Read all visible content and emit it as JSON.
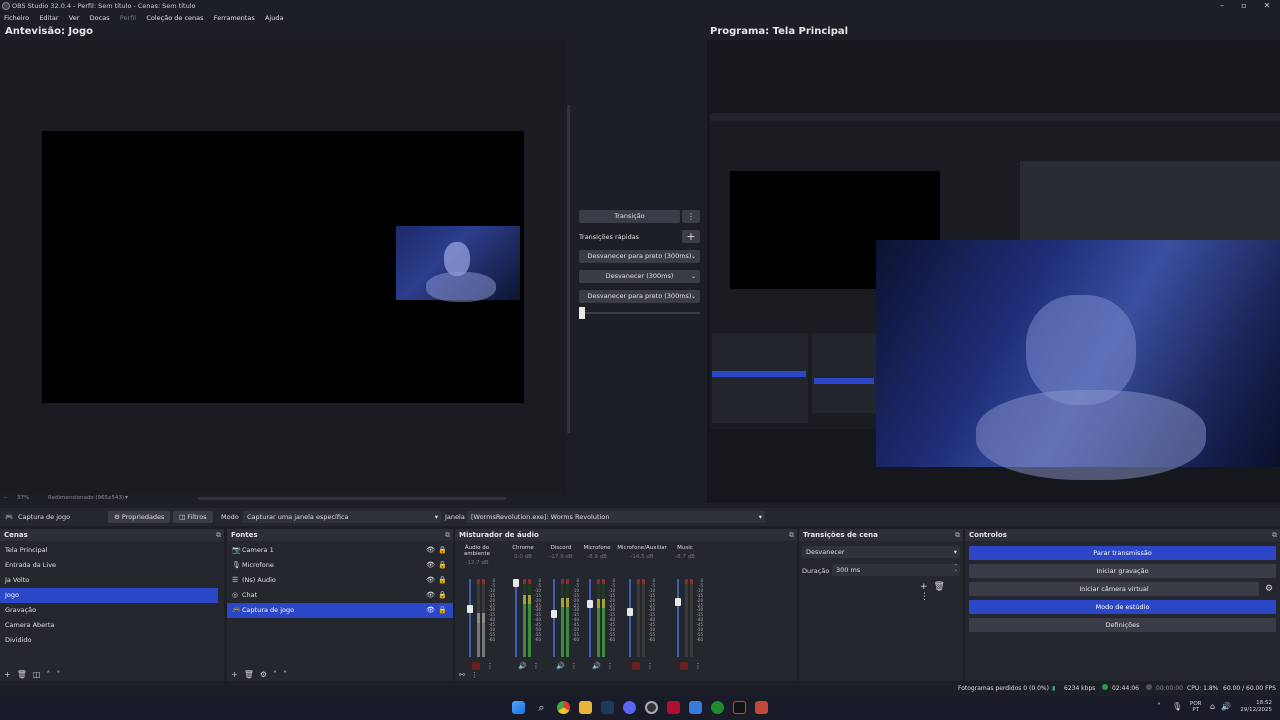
{
  "window": {
    "title": "OBS Studio 32.0.4 - Perfil: Sem título - Cenas: Sem título"
  },
  "menu": [
    "Ficheiro",
    "Editar",
    "Ver",
    "Docas",
    "Perfil",
    "Coleção de cenas",
    "Ferramentas",
    "Ajuda"
  ],
  "preview": {
    "title": "Antevisão: Jogo",
    "zoom": "37%",
    "resize_info": "Redimensionado (965x543)"
  },
  "program": {
    "title": "Programa: Tela Principal"
  },
  "transition_panel": {
    "transition_label": "Transição",
    "quick_label": "Transições rápidas",
    "quick": [
      "Desvanecer para preto (300ms)",
      "Desvanecer (300ms)",
      "Desvanecer para preto (300ms)"
    ]
  },
  "source_bar": {
    "source_name": "Captura de jogo",
    "properties": "Propriedades",
    "filters": "Filtros",
    "mode_label": "Modo",
    "mode_value": "Capturar uma janela específica",
    "window_label": "Janela",
    "window_value": "[WormsRevolution.exe]: Worms Revolution"
  },
  "scenes": {
    "title": "Cenas",
    "items": [
      "Tela Principal",
      "Entrada da Live",
      "Ja Volto",
      "Jogo",
      "Gravação",
      "Camera Aberta",
      "Dividido"
    ],
    "selected_index": 3
  },
  "sources": {
    "title": "Fontes",
    "items": [
      {
        "icon": "camera-icon",
        "label": "Camera 1"
      },
      {
        "icon": "microphone-icon",
        "label": "Microfone"
      },
      {
        "icon": "list-icon",
        "label": "(Ns) Audio"
      },
      {
        "icon": "browser-icon",
        "label": "Chat"
      },
      {
        "icon": "gamepad-icon",
        "label": "Captura de jogo"
      }
    ],
    "selected_index": 4
  },
  "mixer": {
    "title": "Misturador de áudio",
    "channels": [
      {
        "name": "Áudio do ambiente",
        "db": "-12.7 dB",
        "muted": true,
        "level": 0.55,
        "fader": 0.62
      },
      {
        "name": "Chrome",
        "db": "0.0 dB",
        "muted": false,
        "level": 0.85,
        "fader": 0.95
      },
      {
        "name": "Discord",
        "db": "-17.9 dB",
        "muted": false,
        "level": 0.8,
        "fader": 0.55
      },
      {
        "name": "Microfone",
        "db": "-8.9 dB",
        "muted": false,
        "level": 0.78,
        "fader": 0.68
      },
      {
        "name": "Microfone/Auxiliar",
        "db": "-14.5 dB",
        "muted": true,
        "level": 0.0,
        "fader": 0.58
      },
      {
        "name": "Music",
        "db": "-8.7 dB",
        "muted": true,
        "level": 0.0,
        "fader": 0.7
      }
    ],
    "ticks": [
      "0",
      "-5",
      "-10",
      "-15",
      "-20",
      "-25",
      "-30",
      "-35",
      "-40",
      "-45",
      "-50",
      "-55",
      "-60"
    ]
  },
  "scene_transitions": {
    "title": "Transições de cena",
    "selected": "Desvanecer",
    "duration_label": "Duração",
    "duration_value": "300 ms"
  },
  "controls": {
    "title": "Controlos",
    "buttons": [
      "Parar transmissão",
      "Iniciar gravação",
      "Iniciar câmera virtual",
      "Modo de estúdio",
      "Definições"
    ]
  },
  "status": {
    "dropped": "Fotogramas perdidos 0 (0.0%)",
    "bitrate": "6234 kbps",
    "live_time": "02:44:06",
    "rec_time": "00:00:00",
    "cpu": "CPU: 1.8%",
    "fps": "60.00 / 60.00 FPS"
  },
  "clock": {
    "lang1": "POR",
    "lang2": "PT",
    "time": "18:52",
    "date": "29/12/2025"
  }
}
